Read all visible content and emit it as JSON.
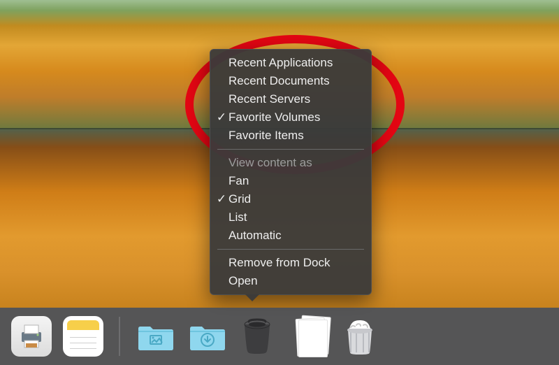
{
  "menu": {
    "section1": [
      {
        "label": "Recent Applications",
        "checked": false
      },
      {
        "label": "Recent Documents",
        "checked": false
      },
      {
        "label": "Recent Servers",
        "checked": false
      },
      {
        "label": "Favorite Volumes",
        "checked": true
      },
      {
        "label": "Favorite Items",
        "checked": false
      }
    ],
    "view_header": "View content as",
    "section2": [
      {
        "label": "Fan",
        "checked": false
      },
      {
        "label": "Grid",
        "checked": true
      },
      {
        "label": "List",
        "checked": false
      },
      {
        "label": "Automatic",
        "checked": false
      }
    ],
    "section3": [
      {
        "label": "Remove from Dock"
      },
      {
        "label": "Open"
      }
    ]
  },
  "dock_icons": [
    {
      "name": "printer-app-icon"
    },
    {
      "name": "notes-app-icon"
    },
    {
      "name": "divider"
    },
    {
      "name": "pictures-folder-icon"
    },
    {
      "name": "downloads-folder-icon"
    },
    {
      "name": "recent-items-stack-icon"
    },
    {
      "name": "documents-stack-icon"
    },
    {
      "name": "trash-icon"
    }
  ]
}
